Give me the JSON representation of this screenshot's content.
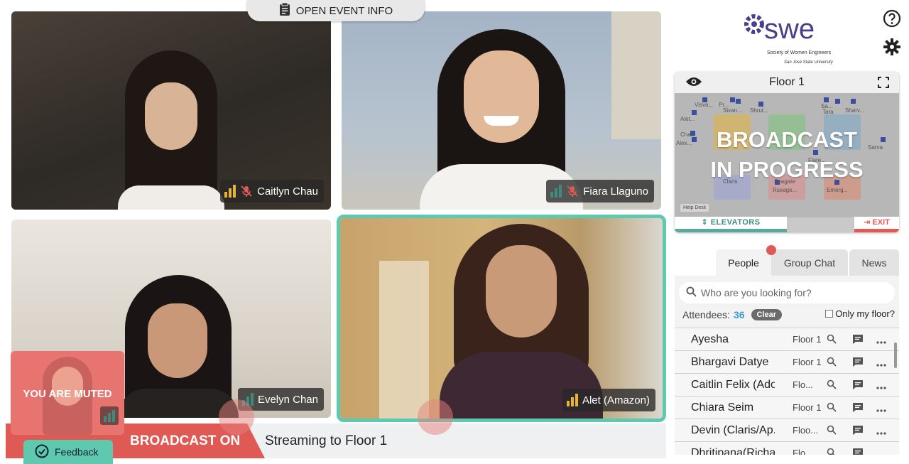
{
  "header": {
    "open_event_info": "OPEN EVENT INFO"
  },
  "participants": [
    {
      "name": "Caitlyn Chau",
      "signal_bars": 3,
      "signal_color": "#e6b23a",
      "muted": true
    },
    {
      "name": "Fiara Llaguno",
      "signal_bars": 3,
      "signal_color": "#3f8a7c",
      "muted": true
    },
    {
      "name": "Evelyn Chan",
      "signal_bars": 3,
      "signal_color": "#3f8a7c",
      "muted": false
    },
    {
      "name": "Alet (Amazon)",
      "signal_bars": 3,
      "signal_color": "#e6b23a",
      "muted": false,
      "active_speaker": true
    }
  ],
  "self_view": {
    "label": "YOU ARE MUTED"
  },
  "broadcast": {
    "status": "BROADCAST ON",
    "streaming": "Streaming to Floor 1"
  },
  "feedback": {
    "label": "Feedback"
  },
  "logo": {
    "brand": "swe",
    "line1": "Society of Women Engineers",
    "line2": "San José State University"
  },
  "floor_card": {
    "title": "Floor 1",
    "overlay_line1": "BROADCAST",
    "overlay_line2": "IN PROGRESS",
    "elevators": "ELEVATORS",
    "exit": "EXIT",
    "help_desk": "Help Desk",
    "map_labels": [
      "Visva...",
      "Pr...",
      "Sivan...",
      "Shrut...",
      "Alet...",
      "Char...",
      "Alex...",
      "Claris",
      "Seagate",
      "Rseage...",
      "Sarva",
      "Flare...",
      "Emerg...",
      "Sa...",
      "Tara",
      "Sharv..."
    ]
  },
  "tabs": [
    {
      "label": "People",
      "active": true
    },
    {
      "label": "Group Chat",
      "active": false
    },
    {
      "label": "News",
      "active": false
    }
  ],
  "people": {
    "search_placeholder": "Who are you looking for?",
    "attendees_label": "Attendees:",
    "attendees_count": "36",
    "clear": "Clear",
    "only_my_floor": "Only my floor?",
    "rows": [
      {
        "name": "Ayesha",
        "floor": "Floor 1"
      },
      {
        "name": "Bhargavi Datye",
        "floor": "Floor 1"
      },
      {
        "name": "Caitlin Felix (Ado...",
        "floor": "Flo..."
      },
      {
        "name": "Chiara Seim",
        "floor": "Floor 1"
      },
      {
        "name": "Devin (Claris/Ap...",
        "floor": "Floo..."
      },
      {
        "name": "Dhritipana(Richa)",
        "floor": "Flo..."
      }
    ]
  },
  "colors": {
    "accent_teal": "#5fc9b0",
    "broadcast_red": "#e05a55",
    "brand_purple": "#4a3f8a"
  }
}
